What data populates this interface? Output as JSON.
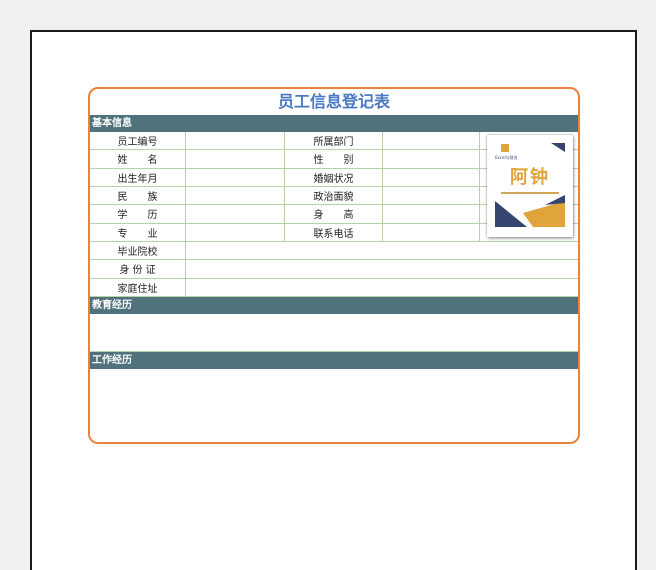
{
  "form": {
    "title": "员工信息登记表",
    "sections": {
      "basic": "基本信息",
      "education": "教育经历",
      "work": "工作经历"
    },
    "rows": [
      {
        "label1": "员工编号",
        "label2": "所属部门"
      },
      {
        "label1": "姓　　名",
        "label2": "性　　别"
      },
      {
        "label1": "出生年月",
        "label2": "婚姻状况"
      },
      {
        "label1": "民　　族",
        "label2": "政治面貌"
      },
      {
        "label1": "学　　历",
        "label2": "身　　高"
      },
      {
        "label1": "专　　业",
        "label2": "联系电话"
      }
    ],
    "wide_rows": [
      {
        "label": "毕业院校"
      },
      {
        "label": "身 份 证"
      },
      {
        "label": "家庭住址"
      }
    ],
    "photo": {
      "brand": "Excel与财务",
      "name": "阿钟",
      "colors": {
        "navy": "#35456f",
        "gold": "#e1a33c"
      }
    }
  },
  "colors": {
    "border_orange": "#e9823a",
    "section_bar": "#4f727c",
    "title_blue": "#4a78c2",
    "grid_green": "#b5d3a6"
  }
}
